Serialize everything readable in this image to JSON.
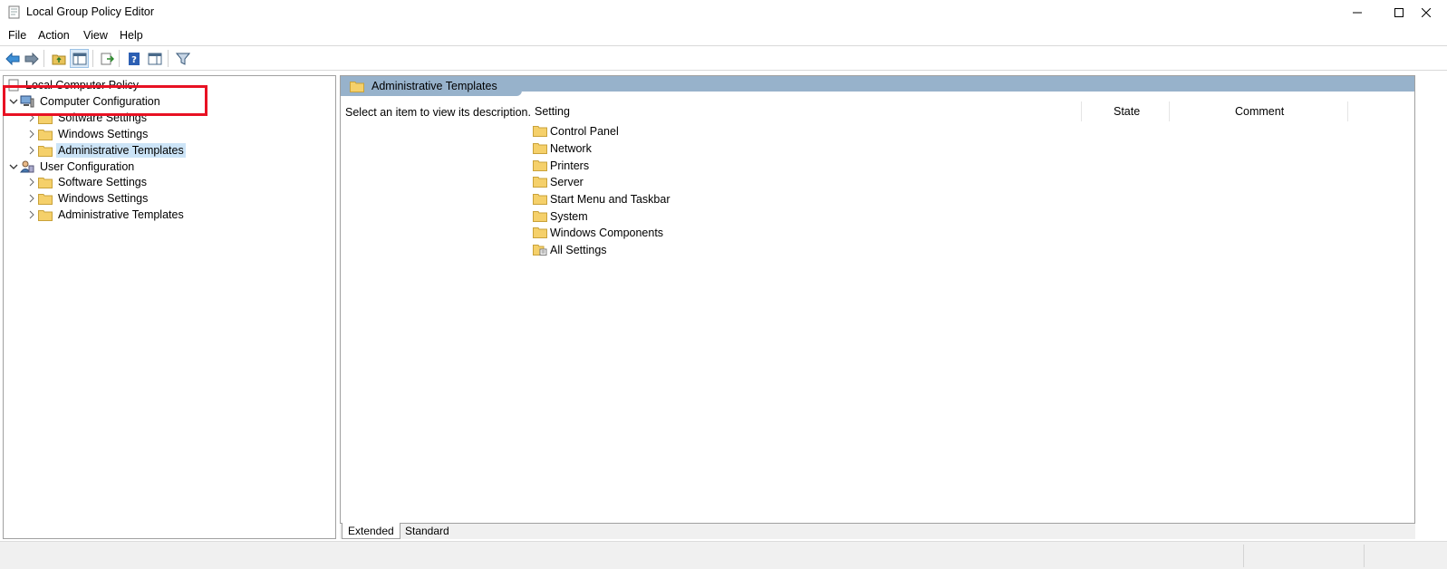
{
  "window": {
    "title": "Local Group Policy Editor",
    "minimize_icon": "minimize-icon",
    "maximize_icon": "maximize-icon",
    "close_icon": "close-icon"
  },
  "menu": [
    "File",
    "Action",
    "View",
    "Help"
  ],
  "toolbar": {
    "buttons": [
      "back-arrow-icon",
      "forward-arrow-icon",
      "up-folder-icon",
      "show-hide-console-tree-icon",
      "export-list-icon",
      "help-icon",
      "show-hide-action-pane-icon",
      "filter-icon"
    ]
  },
  "tree": {
    "root": "Local Computer Policy",
    "computer": {
      "label": "Computer Configuration",
      "children": [
        "Software Settings",
        "Windows Settings",
        "Administrative Templates"
      ]
    },
    "user": {
      "label": "User Configuration",
      "children": [
        "Software Settings",
        "Windows Settings",
        "Administrative Templates"
      ]
    }
  },
  "details": {
    "header": "Administrative Templates",
    "description": "Select an item to view its description.",
    "columns": {
      "setting": "Setting",
      "state": "State",
      "comment": "Comment"
    },
    "items": [
      "Control Panel",
      "Network",
      "Printers",
      "Server",
      "Start Menu and Taskbar",
      "System",
      "Windows Components"
    ],
    "all_settings": "All Settings"
  },
  "tabs": {
    "extended": "Extended",
    "standard": "Standard"
  },
  "colors": {
    "selection": "#cce4f7",
    "header": "#97b2cb",
    "highlight": "#e81123",
    "folder": "#f5d06a"
  }
}
